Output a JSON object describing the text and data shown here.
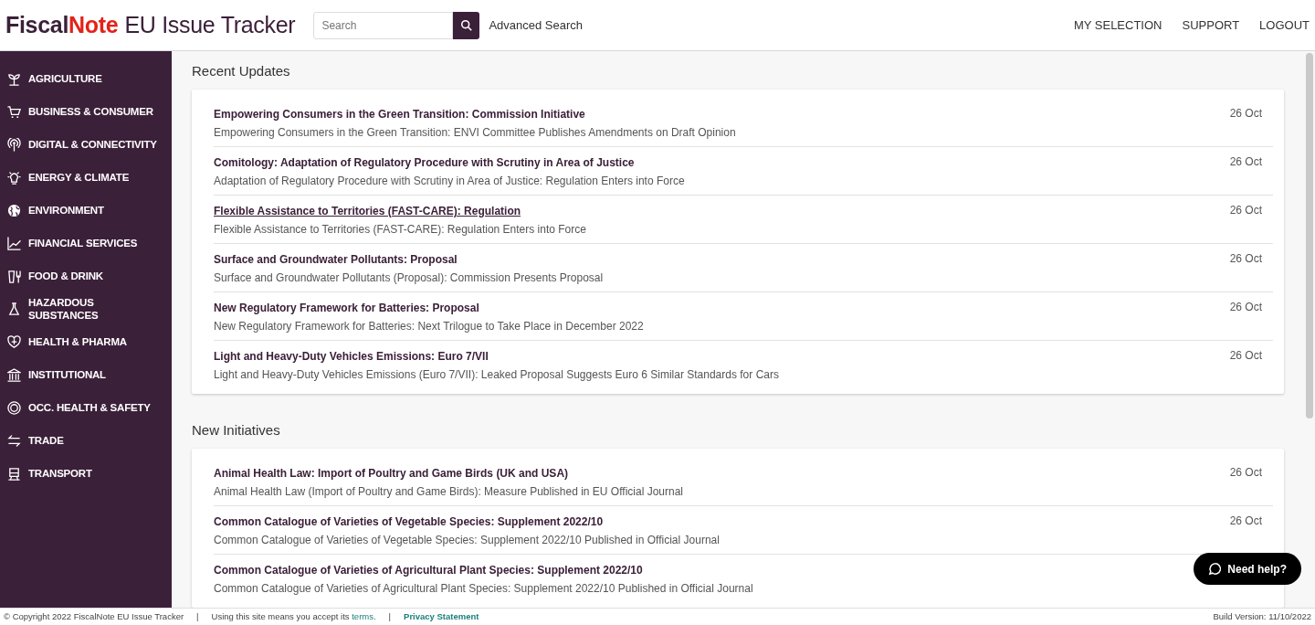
{
  "header": {
    "logo": {
      "part_1": "Fiscal",
      "part_2": "Note",
      "part_3": "EU Issue Tracker"
    },
    "search": {
      "placeholder": "Search"
    },
    "advanced_search": "Advanced Search",
    "nav": [
      "MY SELECTION",
      "SUPPORT",
      "LOGOUT"
    ]
  },
  "sidebar": {
    "items": [
      {
        "label": "AGRICULTURE"
      },
      {
        "label": "BUSINESS & CONSUMER"
      },
      {
        "label": "DIGITAL & CONNECTIVITY"
      },
      {
        "label": "ENERGY & CLIMATE"
      },
      {
        "label": "ENVIRONMENT"
      },
      {
        "label": "FINANCIAL SERVICES"
      },
      {
        "label": "FOOD & DRINK"
      },
      {
        "label": "HAZARDOUS SUBSTANCES"
      },
      {
        "label": "HEALTH & PHARMA"
      },
      {
        "label": "INSTITUTIONAL"
      },
      {
        "label": "OCC. HEALTH & SAFETY"
      },
      {
        "label": "TRADE"
      },
      {
        "label": "TRANSPORT"
      }
    ]
  },
  "sections": [
    {
      "title": "Recent Updates",
      "items": [
        {
          "title": "Empowering Consumers in the Green Transition: Commission Initiative",
          "summary": "Empowering Consumers in the Green Transition: ENVI Committee Publishes Amendments on Draft Opinion",
          "date": "26 Oct",
          "hovered": false
        },
        {
          "title": "Comitology: Adaptation of Regulatory Procedure with Scrutiny in Area of Justice",
          "summary": "Adaptation of Regulatory Procedure with Scrutiny in Area of Justice: Regulation Enters into Force",
          "date": "26 Oct",
          "hovered": false
        },
        {
          "title": "Flexible Assistance to Territories (FAST-CARE): Regulation",
          "summary": "Flexible Assistance to Territories (FAST-CARE): Regulation Enters into Force",
          "date": "26 Oct",
          "hovered": true
        },
        {
          "title": "Surface and Groundwater Pollutants: Proposal",
          "summary": "Surface and Groundwater Pollutants (Proposal): Commission Presents Proposal",
          "date": "26 Oct",
          "hovered": false
        },
        {
          "title": "New Regulatory Framework for Batteries: Proposal",
          "summary": "New Regulatory Framework for Batteries: Next Trilogue to Take Place in December 2022",
          "date": "26 Oct",
          "hovered": false
        },
        {
          "title": "Light and Heavy-Duty Vehicles Emissions: Euro 7/VII",
          "summary": "Light and Heavy-Duty Vehicles Emissions (Euro 7/VII): Leaked Proposal Suggests Euro 6 Similar Standards for Cars",
          "date": "26 Oct",
          "hovered": false
        }
      ]
    },
    {
      "title": "New Initiatives",
      "items": [
        {
          "title": "Animal Health Law: Import of Poultry and Game Birds (UK and USA)",
          "summary": "Animal Health Law (Import of Poultry and Game Birds): Measure Published in EU Official Journal",
          "date": "26 Oct",
          "hovered": false
        },
        {
          "title": "Common Catalogue of Varieties of Vegetable Species: Supplement 2022/10",
          "summary": "Common Catalogue of Varieties of Vegetable Species: Supplement 2022/10 Published in Official Journal",
          "date": "26 Oct",
          "hovered": false
        },
        {
          "title": "Common Catalogue of Varieties of Agricultural Plant Species: Supplement 2022/10",
          "summary": "Common Catalogue of Varieties of Agricultural Plant Species: Supplement 2022/10 Published in Official Journal",
          "hovered": false
        }
      ]
    }
  ],
  "help_button": "Need help?",
  "footer": {
    "copyright": "© Copyright 2022 FiscalNote EU Issue Tracker",
    "terms_text": "Using this site means you accept its ",
    "terms_link": "terms",
    "terms_end": ".",
    "separators": [
      "|",
      "|"
    ],
    "privacy": "Privacy Statement",
    "build": "Build Version: 11/10/2022"
  }
}
